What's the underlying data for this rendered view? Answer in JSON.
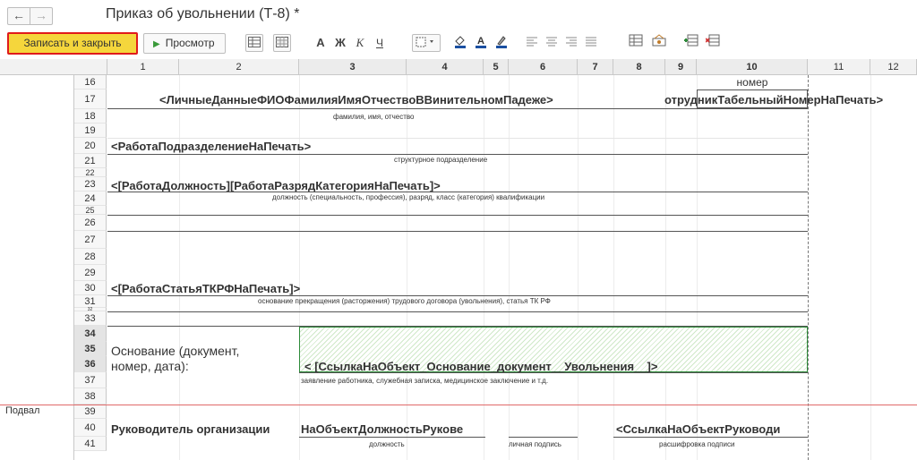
{
  "window": {
    "title": "Приказ об увольнении (Т-8) *"
  },
  "nav": {
    "back": "←",
    "forward": "→"
  },
  "toolbar": {
    "save_close": "Записать и закрыть",
    "preview": "Просмотр",
    "bold": "А",
    "bold2": "Ж",
    "italic": "К",
    "underline": "Ч"
  },
  "columns": [
    "1",
    "2",
    "3",
    "4",
    "5",
    "6",
    "7",
    "8",
    "9",
    "10",
    "11",
    "12"
  ],
  "rows": [
    "16",
    "17",
    "18",
    "19",
    "20",
    "21",
    "22",
    "23",
    "24",
    "25",
    "26",
    "27",
    "28",
    "29",
    "30",
    "31",
    "32",
    "33",
    "34",
    "35",
    "36",
    "37",
    "38",
    "39",
    "40",
    "41"
  ],
  "groups": {
    "footer": "Подвал"
  },
  "cells": {
    "r16_number": "номер",
    "r17_fio": "<ЛичныеДанныеФИОФамилияИмяОтчествоВВинительномПадеже>",
    "r17_tab": "отрудникТабельныйНомерНаПечать>",
    "r18_caption": "фамилия, имя, отчество",
    "r20_dept": "<РаботаПодразделениеНаПечать>",
    "r21_caption": "структурное подразделение",
    "r23_position": "<[РаботаДолжность][РаботаРазрядКатегорияНаПечать]>",
    "r24_caption": "должность (специальность, профессия), разряд, класс (категория) квалификации",
    "r30_article": "<[РаботаСтатьяТКРФНаПечать]>",
    "r31_caption": "основание прекращения (расторжения) трудового договора (увольнения), статья ТК РФ",
    "r35_basis": "Основание (документ,",
    "r36_basis": "номер, дата):",
    "r36_link": "< [СсылкаНаОбъект_Основание_документ__Увольнения__]>",
    "r37_caption": "заявление работника, служебная записка, медицинское заключение и т.д.",
    "r40_head": "Руководитель организации",
    "r40_position": "НаОбъектДолжностьРукове",
    "r40_manager": "<СсылкаНаОбъектРуководи",
    "r41_position": "должность",
    "r41_sign": "личная подпись",
    "r41_decode": "расшифровка подписи"
  }
}
